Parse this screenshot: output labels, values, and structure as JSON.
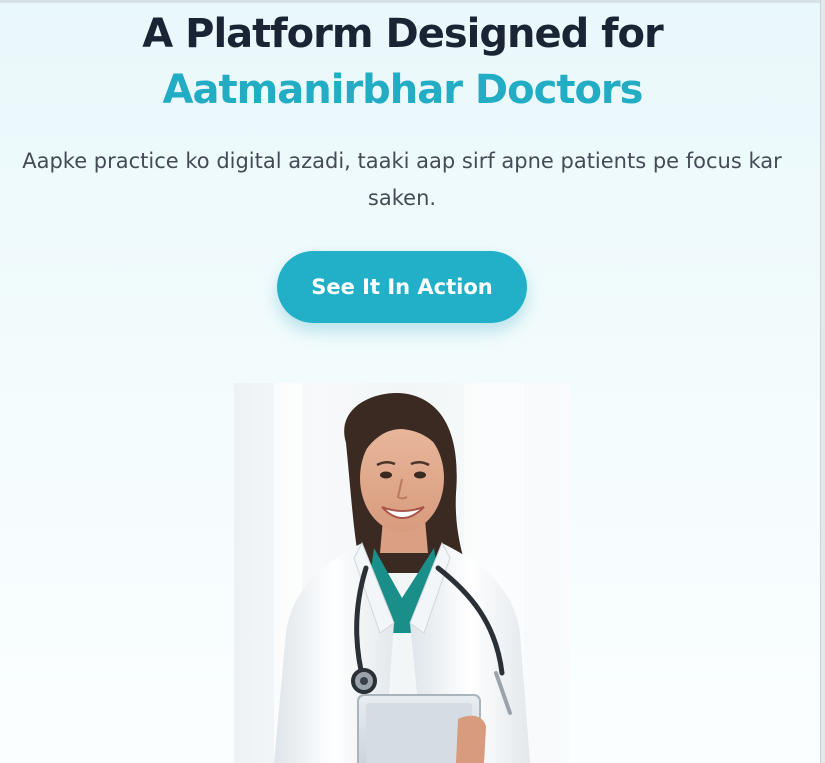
{
  "hero": {
    "headline_line1": "A Platform Designed for",
    "headline_line2": "Aatmanirbhar Doctors",
    "subtitle": "Aapke practice ko digital azadi, taaki aap sirf apne patients pe focus kar saken.",
    "cta_label": "See It In Action"
  },
  "image": {
    "subject": "smiling female doctor in white coat with stethoscope holding a tablet"
  },
  "colors": {
    "heading_dark": "#1b2434",
    "accent_teal": "#22adc4",
    "button_bg": "#22b0c8",
    "subtitle_text": "#454b55",
    "page_bg_top": "#e9f8fb"
  }
}
